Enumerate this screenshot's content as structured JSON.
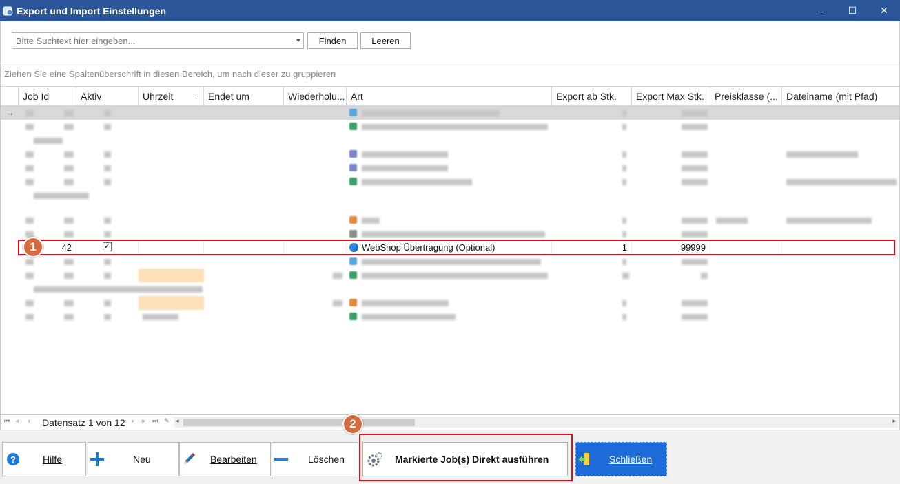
{
  "window": {
    "title": "Export und Import Einstellungen",
    "minimize": "–",
    "maximize": "☐",
    "close": "✕"
  },
  "search": {
    "placeholder": "Bitte Suchtext hier eingeben...",
    "find_label": "Finden",
    "clear_label": "Leeren"
  },
  "group_hint": "Ziehen Sie eine Spaltenüberschrift in diesen Bereich, um nach dieser zu gruppieren",
  "columns": {
    "job_id": "Job Id",
    "aktiv": "Aktiv",
    "uhrzeit": "Uhrzeit",
    "endet_um": "Endet um",
    "wiederholung": "Wiederholu...",
    "art": "Art",
    "export_ab": "Export ab Stk.",
    "export_max": "Export Max Stk.",
    "preisklasse": "Preisklasse (...",
    "dateiname": "Dateiname (mit Pfad)"
  },
  "selected_row": {
    "job_id": "42",
    "aktiv": "✓",
    "art": "WebShop Übertragung (Optional)",
    "export_ab": "1",
    "export_max": "99999"
  },
  "row_indicator": "→",
  "navigator": {
    "record_text": "Datensatz 1 von 12",
    "first": "⏮",
    "prev_page": "«",
    "prev": "‹",
    "next": "›",
    "next_page": "»",
    "last": "⏭",
    "edit": "✎"
  },
  "markers": {
    "one": "1",
    "two": "2"
  },
  "footer": {
    "help": "Hilfe",
    "new": "Neu",
    "edit": "Bearbeiten",
    "delete": "Löschen",
    "run": "Markierte Job(s) Direkt ausführen",
    "close": "Schließen"
  },
  "colors": {
    "title_bar": "#2b579a",
    "highlight_frame": "#d9121b",
    "marker": "#d46a3d",
    "primary_button": "#1c6bd8"
  }
}
